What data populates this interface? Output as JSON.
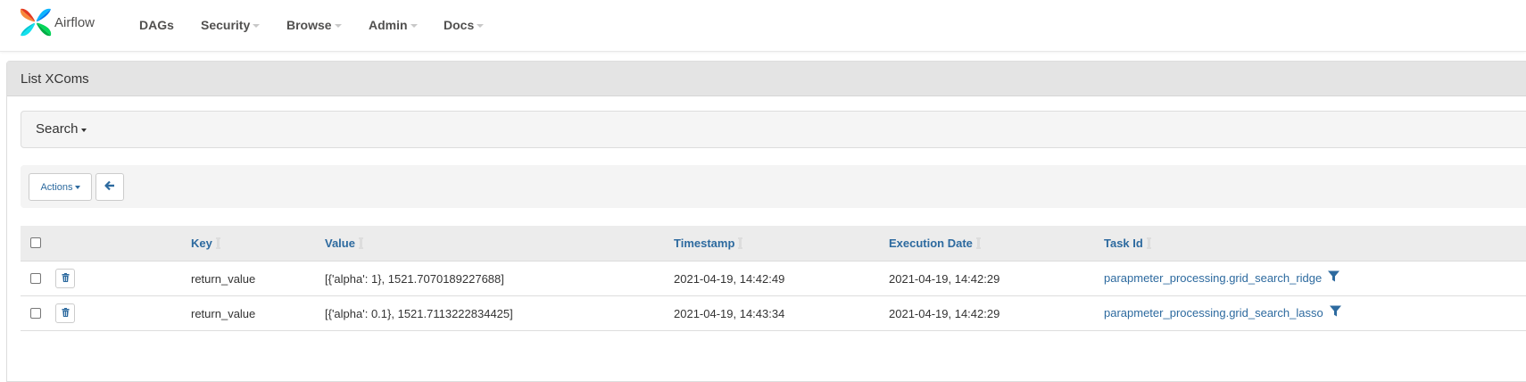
{
  "brand": {
    "name": "Airflow",
    "logo_icon": "airflow-pinwheel-icon"
  },
  "nav": {
    "items": [
      {
        "label": "DAGs",
        "has_dropdown": false
      },
      {
        "label": "Security",
        "has_dropdown": true
      },
      {
        "label": "Browse",
        "has_dropdown": true
      },
      {
        "label": "Admin",
        "has_dropdown": true
      },
      {
        "label": "Docs",
        "has_dropdown": true
      }
    ]
  },
  "panel": {
    "title": "List XComs"
  },
  "search": {
    "label": "Search"
  },
  "actions": {
    "actions_label": "Actions",
    "back_icon": "arrow-left-icon"
  },
  "table": {
    "columns": [
      "Key",
      "Value",
      "Timestamp",
      "Execution Date",
      "Task Id"
    ],
    "rows": [
      {
        "key": "return_value",
        "value": "[{'alpha': 1}, 1521.7070189227688]",
        "timestamp": "2021-04-19, 14:42:49",
        "execution_date": "2021-04-19, 14:42:29",
        "task_id": "parapmeter_processing.grid_search_ridge"
      },
      {
        "key": "return_value",
        "value": "[{'alpha': 0.1}, 1521.7113222834425]",
        "timestamp": "2021-04-19, 14:43:34",
        "execution_date": "2021-04-19, 14:42:29",
        "task_id": "parapmeter_processing.grid_search_lasso"
      }
    ]
  },
  "colors": {
    "link": "#2d6a9f",
    "nav_text": "#51504f",
    "panel_heading_bg": "#e4e4e4",
    "table_header_bg": "#ececec"
  }
}
